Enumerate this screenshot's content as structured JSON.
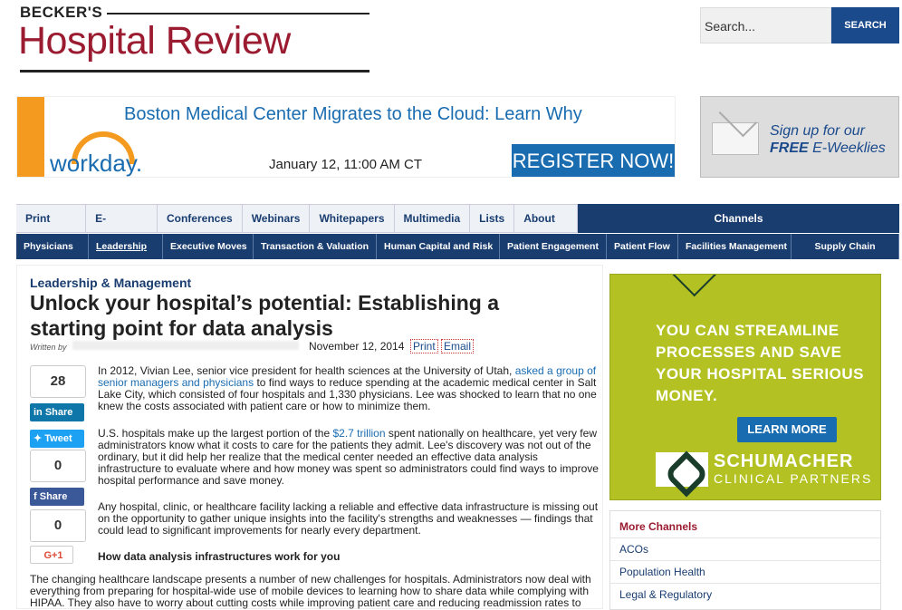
{
  "header": {
    "brand_small": "BECKER'S",
    "brand_big": "Hospital Review",
    "search_placeholder": "Search...",
    "search_button": "SEARCH"
  },
  "ad_banner": {
    "headline": "Boston Medical Center Migrates to the Cloud: Learn Why",
    "brand": "workday.",
    "date": "January 12, 11:00 AM CT",
    "cta": "REGISTER NOW!",
    "accent": "#f49a1f"
  },
  "signup": {
    "line1": "Sign up for our",
    "line2_bold": "FREE",
    "line2_rest": "E-Weeklies"
  },
  "nav_primary": [
    "Print Issue",
    "E-Weeklies",
    "Conferences",
    "Webinars",
    "Whitepapers",
    "Multimedia",
    "Lists",
    "About Us"
  ],
  "channels_label": "Channels",
  "nav_secondary": [
    "Physicians",
    "Leadership",
    "Executive Moves",
    "Transaction & Valuation",
    "Human Capital and Risk",
    "Patient Engagement",
    "Patient Flow",
    "Facilities Management",
    "Supply Chain"
  ],
  "article": {
    "section": "Leadership & Management",
    "title": "Unlock your hospital’s potential: Establishing a starting point for data analysis",
    "written_by": "Written by",
    "date": "November 12, 2014",
    "print": "Print",
    "email": "Email",
    "p1_a": "In 2012, Vivian Lee, senior vice president for health sciences at the University of Utah, ",
    "p1_link": "asked a group of senior managers and physicians",
    "p1_b": " to find ways to reduce spending at the academic medical center in Salt Lake City, which consisted of four hospitals and 1,330 physicians. Lee was shocked to learn that no one knew the costs associated with patient care or how to minimize them.",
    "p2_a": "U.S. hospitals make up the largest portion of the ",
    "p2_link": "$2.7 trillion",
    "p2_b": " spent nationally on healthcare, yet very few administrators know what it costs to care for the patients they admit. Lee's discovery was not out of the ordinary, but it did help her realize that the medical center needed an effective data analysis infrastructure to evaluate where and how money was spent so administrators could find ways to improve hospital performance and save money.",
    "p3": "Any hospital, clinic, or healthcare facility lacking a reliable and effective data infrastructure is missing out on the opportunity to gather unique insights into the facility's strengths and weaknesses — findings that could lead to significant improvements for nearly every department.",
    "subhead": "How data analysis infrastructures work for you",
    "p4": "The changing healthcare landscape presents a number of new challenges for hospitals. Administrators now deal with everything from preparing for hospital-wide use of mobile devices to learning how to share data while complying with HIPAA. They also have to worry about cutting costs while improving patient care and reducing readmission rates to"
  },
  "share": {
    "linkedin_count": "28",
    "linkedin": "Share",
    "twitter": "Tweet",
    "twitter_count": "0",
    "facebook": "Share",
    "facebook_count": "0",
    "gplus": "G+1"
  },
  "sidebar_ad": {
    "text": "YOU CAN STREAMLINE PROCESSES AND SAVE YOUR HOSPITAL SERIOUS MONEY.",
    "cta": "LEARN MORE",
    "brand": "SCHUMACHER",
    "brand_sub": "CLINICAL PARTNERS",
    "bg": "#b3c222"
  },
  "more_channels": {
    "title": "More Channels",
    "items": [
      "ACOs",
      "Population Health",
      "Legal & Regulatory"
    ]
  }
}
